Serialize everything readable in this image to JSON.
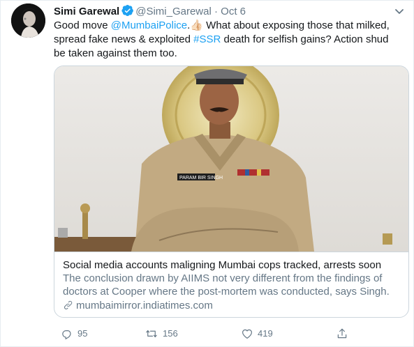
{
  "tweet": {
    "author_name": "Simi Garewal",
    "handle": "@Simi_Garewal",
    "separator": "·",
    "date": "Oct 6",
    "text_start": "Good move ",
    "mention": "@MumbaiPolice",
    "text_mid": ".👍🏻 What about exposing those that milked, spread fake news & exploited ",
    "hashtag": "#SSR",
    "text_end": " death for selfish gains? Action shud be taken against them too."
  },
  "card": {
    "badge_text": "PARAM BIR SINGH",
    "title": "Social media accounts maligning Mumbai cops tracked, arrests soon",
    "description": "The conclusion drawn by AIIMS not very different from the findings of doctors at Cooper where the post-mortem was conducted, says Singh.",
    "domain": "mumbaimirror.indiatimes.com"
  },
  "actions": {
    "replies": "95",
    "retweets": "156",
    "likes": "419"
  },
  "colors": {
    "link": "#1da1f2",
    "secondary_text": "#657786",
    "border": "#ccd6dd"
  }
}
